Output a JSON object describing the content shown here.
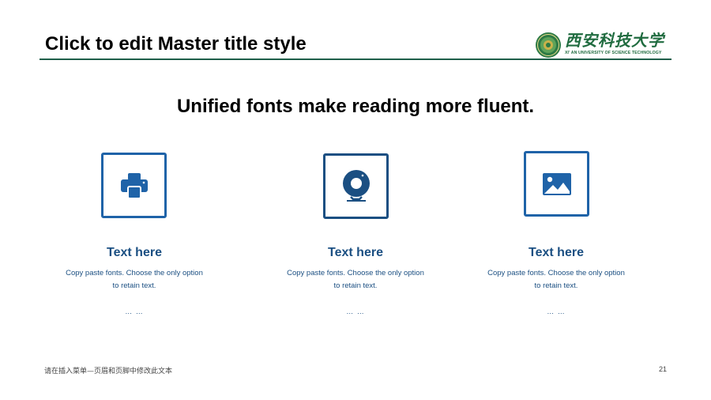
{
  "slide": {
    "master_title": "Click to edit Master title style",
    "headline": "Unified fonts make reading more fluent.",
    "footer_text": "请在插入菜单—页眉和页脚中修改此文本",
    "page_number": "21"
  },
  "logo": {
    "name_cn": "西安科技大学",
    "name_en": "XI' AN UNIVERSITY OF SCIENCE TECHNOLOGY",
    "emblem": "university-seal-icon"
  },
  "features": [
    {
      "icon": "printer-icon",
      "title": "Text here",
      "desc_line1": "Copy paste fonts. Choose the only option",
      "desc_line2": "to retain text.",
      "ellipsis": "… …"
    },
    {
      "icon": "webcam-icon",
      "title": "Text here",
      "desc_line1": "Copy paste fonts. Choose the only option",
      "desc_line2": "to retain text.",
      "ellipsis": "… …"
    },
    {
      "icon": "picture-icon",
      "title": "Text here",
      "desc_line1": "Copy paste fonts. Choose the only option",
      "desc_line2": "to retain text.",
      "ellipsis": "… …"
    }
  ],
  "colors": {
    "accent_blue": "#1f63a8",
    "text_blue": "#1b4f82",
    "rule_green": "#1f5f4a",
    "logo_green": "#1f6b3f"
  }
}
